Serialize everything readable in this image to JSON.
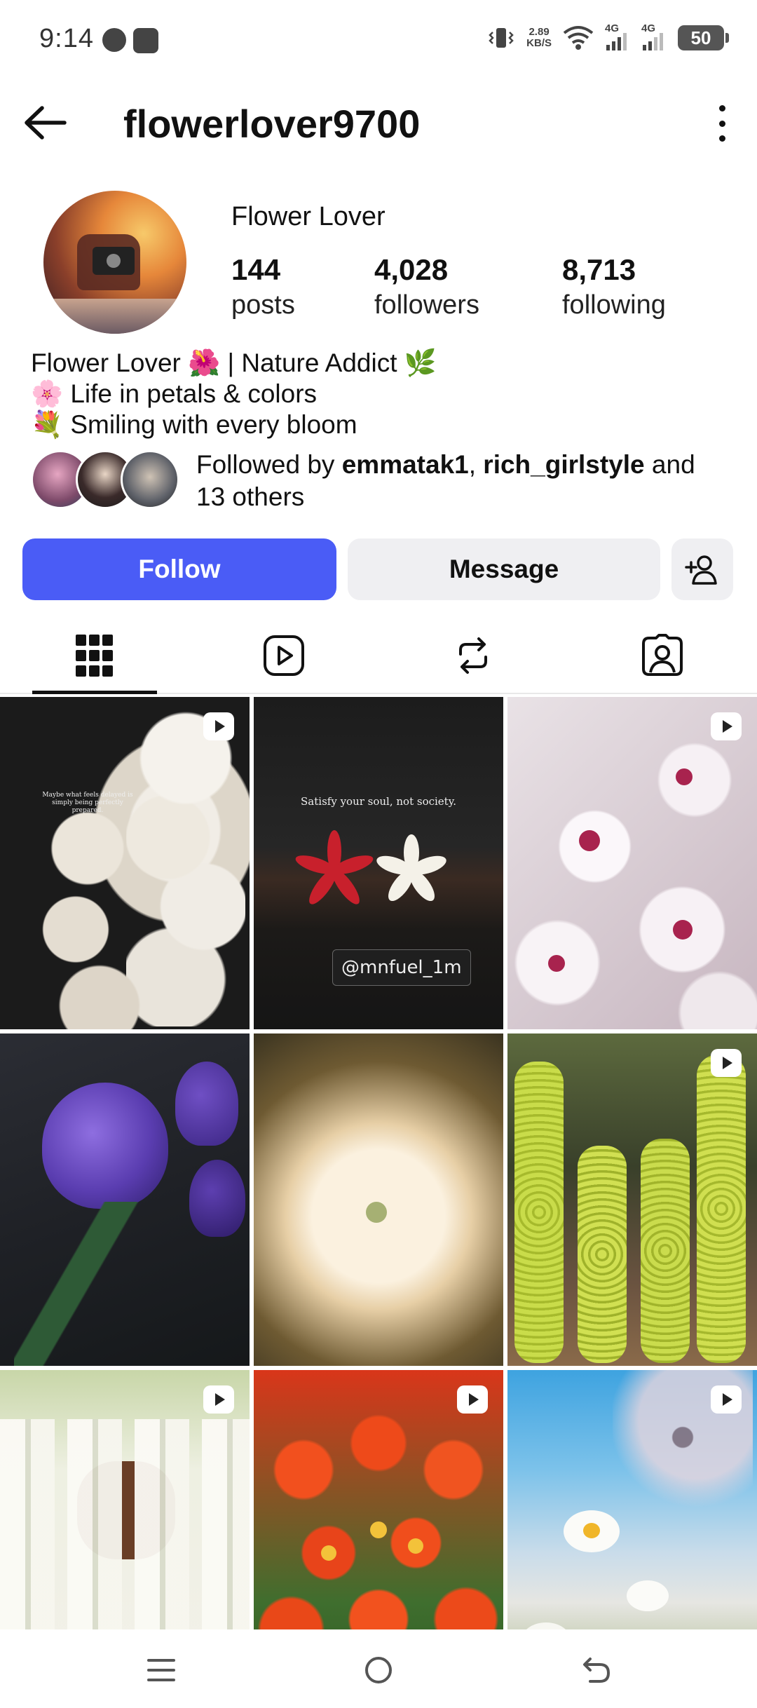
{
  "status_bar": {
    "time": "9:14",
    "net_speed_value": "2.89",
    "net_speed_unit": "KB/S",
    "sim1_label": "4G",
    "sim2_label": "4G",
    "battery": "50"
  },
  "header": {
    "username": "flowerlover9700",
    "back_icon": "arrow-left-icon",
    "more_icon": "more-vertical-icon"
  },
  "profile": {
    "display_name": "Flower Lover",
    "stats": [
      {
        "value": "144",
        "label": "posts"
      },
      {
        "value": "4,028",
        "label": "followers"
      },
      {
        "value": "8,713",
        "label": "following"
      }
    ],
    "bio": [
      "Flower Lover 🌺 | Nature Addict 🌿",
      "🌸 Life in petals & colors",
      "💐 Smiling with every bloom"
    ],
    "followed_by": {
      "prefix": "Followed by ",
      "user1": "emmatak1",
      "separator": ", ",
      "user2": "rich_girlstyle",
      "suffix": " and",
      "others": "13 others"
    }
  },
  "actions": {
    "follow": "Follow",
    "message": "Message",
    "add_user_icon": "add-user-icon"
  },
  "tabs": [
    {
      "icon": "grid-icon",
      "active": true
    },
    {
      "icon": "reels-icon",
      "active": false
    },
    {
      "icon": "reposts-icon",
      "active": false
    },
    {
      "icon": "tagged-icon",
      "active": false
    }
  ],
  "grid": {
    "cell1_caption": "Maybe what feels delayed is simply being perfectly prepared.",
    "cell2_caption": "Satisfy your soul, not society.",
    "cell2_tag": "@mnfuel_1m"
  },
  "colors": {
    "accent": "#4a5cf6",
    "secondary_button": "#efeff2",
    "text": "#111111"
  }
}
